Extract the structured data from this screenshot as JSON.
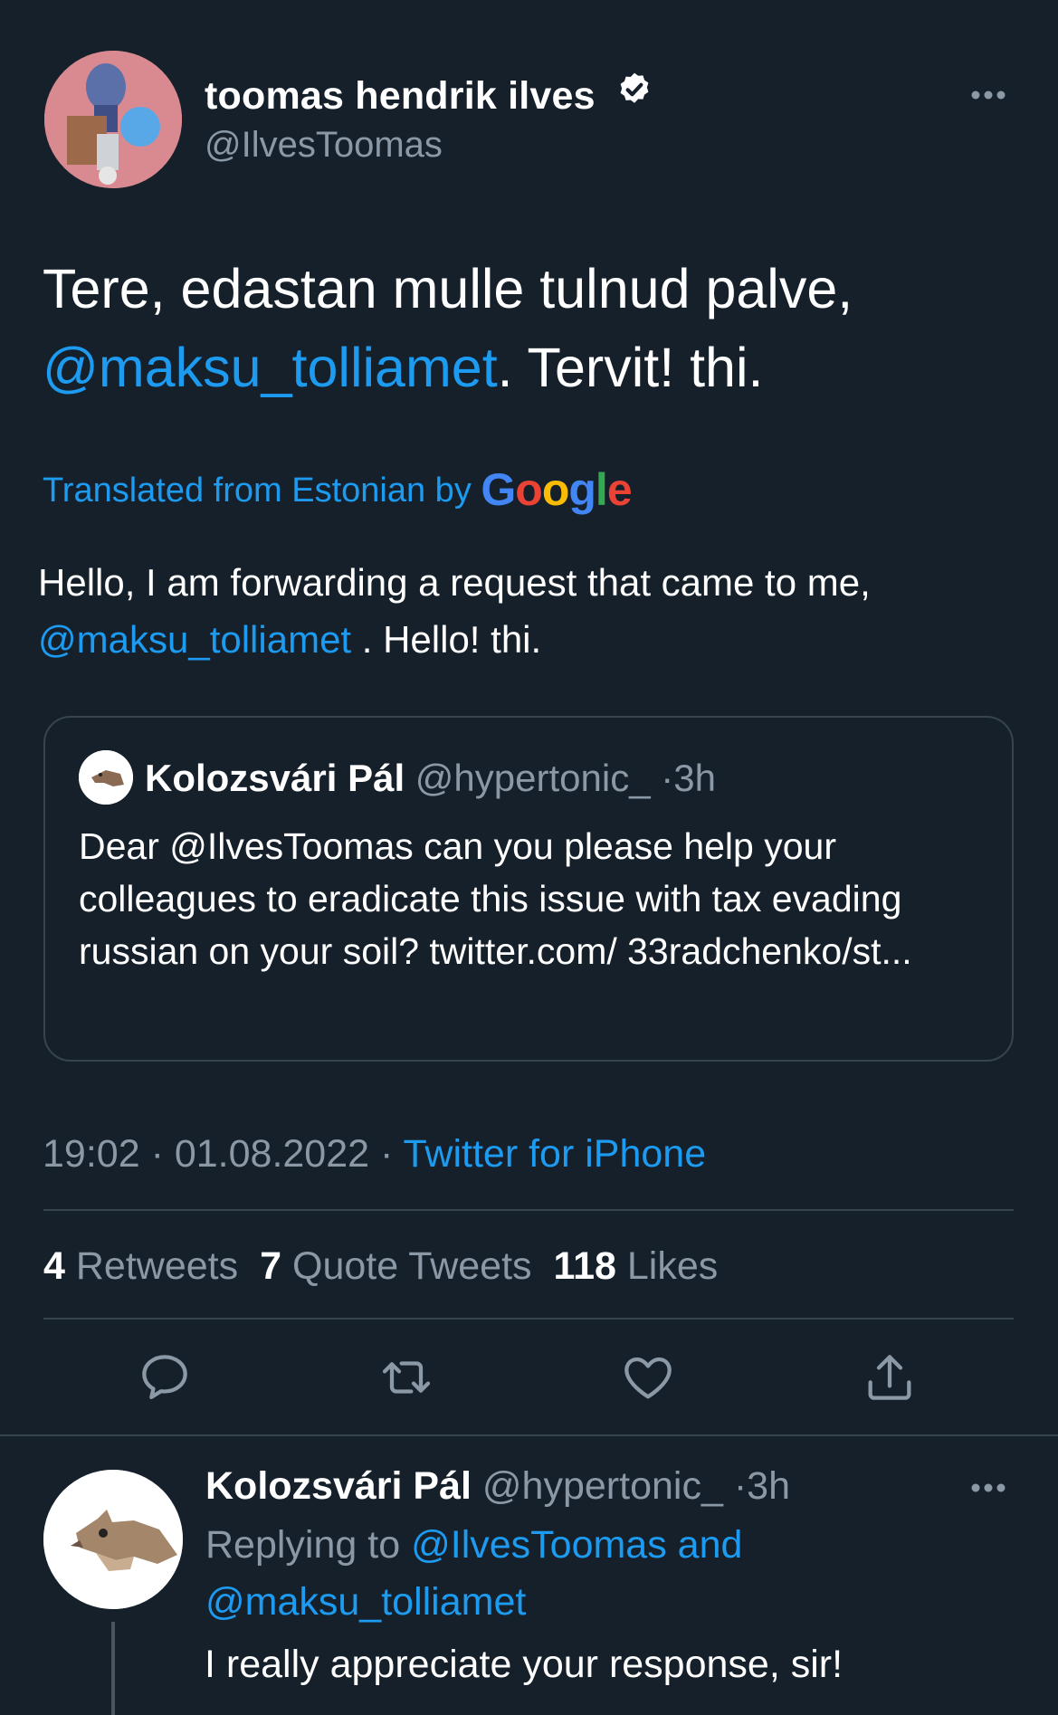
{
  "tweet": {
    "author_name": "toomas hendrik ilves",
    "author_handle": "@IlvesToomas",
    "text_part1": "Tere, edastan mulle tulnud palve,",
    "text_mention": "@maksu_tolliamet",
    "text_part2": ". Tervit! thi.",
    "translated_label": "Translated from Estonian by",
    "translator": "Google",
    "translation_part1": "Hello, I am forwarding a request that came to me,",
    "translation_mention": "@maksu_tolliamet",
    "translation_part2": " . Hello! thi.",
    "time": "19:02",
    "date": "01.08.2022",
    "source": "Twitter for iPhone",
    "separator": "·"
  },
  "quote": {
    "author_name": "Kolozsvári Pál",
    "author_handle": "@hypertonic_",
    "time": "3h",
    "text": "Dear @IlvesToomas can you please help your colleagues to eradicate this issue with tax evading russian on your soil? twitter.com/ 33radchenko/st..."
  },
  "stats": {
    "retweets_count": "4",
    "retweets_label": "Retweets",
    "quotes_count": "7",
    "quotes_label": "Quote Tweets",
    "likes_count": "118",
    "likes_label": "Likes"
  },
  "actions": [
    "reply-icon",
    "retweet-icon",
    "like-icon",
    "share-icon"
  ],
  "reply": {
    "author_name": "Kolozsvári Pál",
    "author_handle": "@hypertonic_",
    "time": "3h",
    "replying_label": "Replying to",
    "replying_handles": "@IlvesToomas and @maksu_tolliamet",
    "text": "I really appreciate your response, sir!"
  },
  "colors": {
    "background": "#15202b",
    "link": "#1d9bf0",
    "muted": "#8b98a5",
    "divider": "#38444d"
  }
}
